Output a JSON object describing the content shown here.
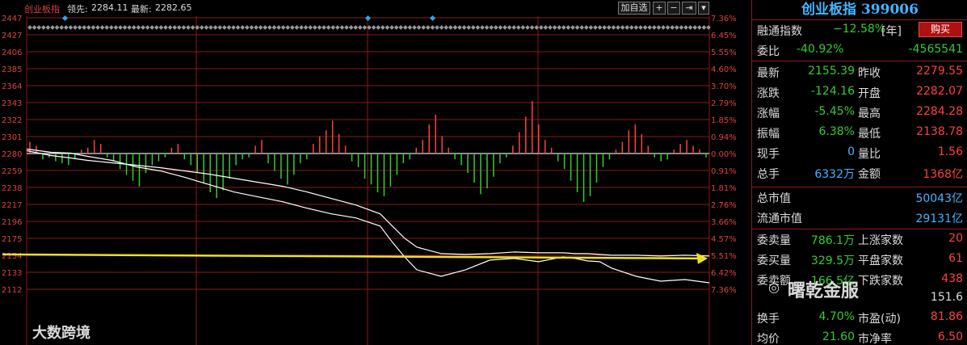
{
  "toolbar": {
    "title": "创业板指",
    "lead_label": "领先:",
    "lead_value": "2284.11",
    "latest_label": "最新:",
    "latest_value": "2282.65",
    "add_button": "加自选",
    "plus_icon": "+",
    "minus_icon": "−",
    "arrow_icon": "⇥",
    "dropdown_icon": "▾"
  },
  "chart_data": {
    "type": "line",
    "prev_close": 2279.55,
    "y_left_ticks": [
      "2447",
      "2427",
      "2406",
      "2385",
      "2364",
      "2343",
      "2322",
      "2301",
      "2280",
      "2259",
      "2238",
      "2217",
      "2196",
      "2175",
      "2154",
      "2133",
      "2112"
    ],
    "y_right_ticks": [
      "7.36%",
      "6.45%",
      "5.55%",
      "4.60%",
      "3.70%",
      "2.79%",
      "1.85%",
      "0.94%",
      "0.00%",
      "0.91%",
      "1.81%",
      "2.76%",
      "3.66%",
      "4.57%",
      "5.51%",
      "6.42%",
      "7.36%"
    ],
    "ylim": [
      2112,
      2447
    ],
    "series": [
      {
        "color": "#ffffff",
        "x": [
          0,
          5,
          10,
          18,
          25,
          35,
          45,
          55,
          65,
          75,
          85,
          95,
          105,
          115,
          125,
          135,
          145,
          150,
          155,
          160,
          170,
          180,
          190,
          200,
          210,
          220,
          225,
          230,
          235,
          240,
          250,
          260,
          270,
          280
        ],
        "values": [
          2285,
          2283,
          2281,
          2280,
          2276,
          2271,
          2263,
          2258,
          2250,
          2241,
          2232,
          2226,
          2220,
          2212,
          2205,
          2200,
          2190,
          2170,
          2152,
          2136,
          2128,
          2136,
          2148,
          2150,
          2146,
          2152,
          2150,
          2147,
          2146,
          2138,
          2128,
          2122,
          2124,
          2120
        ]
      },
      {
        "color": "#ffffff",
        "x": [
          0,
          5,
          10,
          18,
          25,
          35,
          45,
          55,
          65,
          75,
          85,
          95,
          105,
          115,
          125,
          135,
          145,
          150,
          155,
          160,
          170,
          180,
          190,
          200,
          210,
          220,
          225,
          230,
          235,
          240,
          250,
          260,
          270,
          280
        ],
        "values": [
          2283,
          2280,
          2277,
          2274,
          2271,
          2268,
          2265,
          2262,
          2258,
          2254,
          2249,
          2244,
          2239,
          2232,
          2224,
          2216,
          2205,
          2190,
          2175,
          2164,
          2156,
          2155,
          2156,
          2158,
          2157,
          2157,
          2156,
          2156,
          2155,
          2154,
          2154,
          2153,
          2154,
          2153
        ]
      }
    ],
    "volume_bars": [
      12,
      8,
      -6,
      -4,
      -8,
      -10,
      -12,
      -6,
      4,
      6,
      14,
      10,
      -4,
      -8,
      -16,
      -22,
      -28,
      -34,
      -20,
      -12,
      -8,
      -4,
      6,
      10,
      -6,
      -12,
      -20,
      -30,
      -40,
      -46,
      -38,
      -26,
      -12,
      -6,
      -4,
      8,
      14,
      -10,
      -18,
      -26,
      -32,
      -22,
      -10,
      -6,
      10,
      18,
      24,
      34,
      20,
      8,
      -8,
      -14,
      -26,
      -32,
      -40,
      -44,
      -34,
      -22,
      -10,
      -6,
      6,
      14,
      30,
      40,
      18,
      6,
      -6,
      -12,
      -20,
      -30,
      -42,
      -36,
      -24,
      -10,
      -4,
      8,
      22,
      38,
      54,
      30,
      14,
      6,
      -8,
      -16,
      -28,
      -40,
      -50,
      -44,
      -30,
      -14,
      -6,
      4,
      12,
      24,
      30,
      20,
      8,
      -4,
      -8,
      -6,
      4,
      10,
      14,
      8,
      4,
      -4
    ],
    "annotations": []
  },
  "panel": {
    "title": "创业板指 399006",
    "row1": {
      "label": "融通指数",
      "value": "−12.58%",
      "tag": "[年]",
      "button": "购买"
    },
    "row2": {
      "label": "委比",
      "value": "-40.92%",
      "value2": "-4565541"
    },
    "rows": [
      {
        "l1": "最新",
        "v1": "2155.39",
        "l2": "昨收",
        "v2": "2279.55"
      },
      {
        "l1": "涨跌",
        "v1": "-124.16",
        "l2": "开盘",
        "v2": "2282.07"
      },
      {
        "l1": "涨幅",
        "v1": "-5.45%",
        "l2": "最高",
        "v2": "2284.28"
      },
      {
        "l1": "振幅",
        "v1": "6.38%",
        "l2": "最低",
        "v2": "2138.78"
      },
      {
        "l1": "现手",
        "v1": "0",
        "l2": "量比",
        "v2": "1.56"
      },
      {
        "l1": "总手",
        "v1": "6332万",
        "l2": "金额",
        "v2": "1368亿"
      }
    ],
    "market_total": {
      "label": "总市值",
      "value": "50043亿"
    },
    "market_float": {
      "label": "流通市值",
      "value": "29131亿"
    },
    "depth": [
      {
        "l1": "委卖量",
        "v1": "786.1万",
        "l2": "上涨家数",
        "v2": "20"
      },
      {
        "l1": "委买量",
        "v1": "329.5万",
        "l2": "平盘家数",
        "v2": "61"
      },
      {
        "l1": "委卖额",
        "v1": "166.5亿",
        "l2": "下跌家数",
        "v2": "438"
      }
    ],
    "bottom": [
      {
        "l1": "换手",
        "v1": "4.70%",
        "l2": "市盈(动)",
        "v2": "81.86"
      },
      {
        "l1": "均价",
        "v1": "21.60",
        "l2": "市净率",
        "v2": "6.50"
      }
    ],
    "pe_value": "151.6"
  },
  "watermarks": {
    "left": "大数跨境",
    "right": "曙乾金服"
  },
  "colors": {
    "up": "#ff4040",
    "down": "#33cc33",
    "grid": "#8b1a1a",
    "axis_text": "#e04040",
    "arrow": "#f0e020"
  }
}
